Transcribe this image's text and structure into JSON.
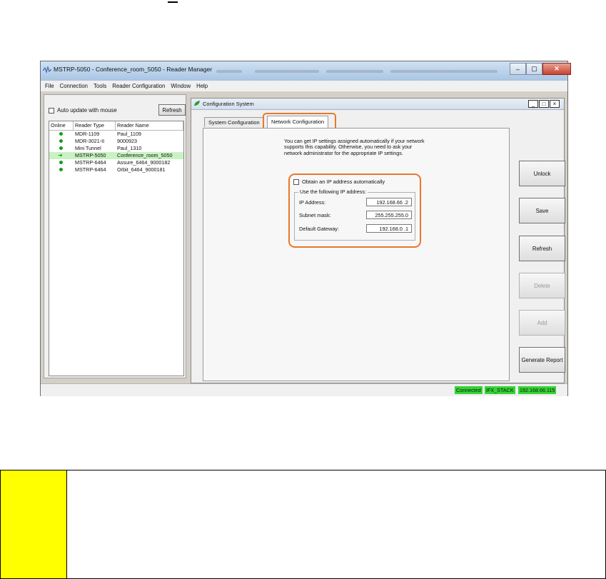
{
  "window": {
    "title": "MSTRP-5050 - Conference_room_5050 - Reader Manager",
    "menu": [
      "File",
      "Connection",
      "Tools",
      "Reader Configuration",
      "Window",
      "Help"
    ]
  },
  "left_panel": {
    "auto_update_label": "Auto update with mouse",
    "refresh_label": "Refresh",
    "columns": [
      "Online",
      "Reader Type",
      "Reader Name"
    ],
    "rows": [
      {
        "type": "MDR-1109",
        "name": "Paul_1109",
        "status": "online"
      },
      {
        "type": "MDR-3021-II",
        "name": "9000923",
        "status": "online"
      },
      {
        "type": "Mini Tunnel",
        "name": "Paul_1310",
        "status": "online"
      },
      {
        "type": "MSTRP-5050",
        "name": "Conference_room_5050",
        "status": "selected"
      },
      {
        "type": "MSTRP-6464",
        "name": "Assure_6464_9000182",
        "status": "online"
      },
      {
        "type": "MSTRP-6464",
        "name": "Orbit_6464_9000181",
        "status": "online"
      }
    ]
  },
  "config": {
    "title": "Configuration System",
    "tabs": [
      "System Configuration",
      "Network Configuration"
    ],
    "info_text": "You can get IP settings assigned automatically if your network supports this capability. Otherwise, you need to ask your network administrator for the appropriate IP settings.",
    "obtain_auto_label": "Obtain an IP address automatically",
    "group_label": "Use the following IP address:",
    "fields": [
      {
        "label": "IP Address:",
        "value": "192.168.66 .2"
      },
      {
        "label": "Subnet mask:",
        "value": "255.255.255.0"
      },
      {
        "label": "Default Gateway:",
        "value": "192.168.0 .1"
      }
    ],
    "buttons": {
      "unlock": "Unlock",
      "save": "Save",
      "refresh": "Refresh",
      "delete": "Delete",
      "add": "Add",
      "generate_report": "Generate Report"
    }
  },
  "status": {
    "connection": "Connected",
    "stack": "IFX_STACK",
    "ip": "192.168.66.115"
  },
  "colors": {
    "highlight": "#e8782a",
    "status_green": "#35d435",
    "note_marker": "#ffff00"
  }
}
